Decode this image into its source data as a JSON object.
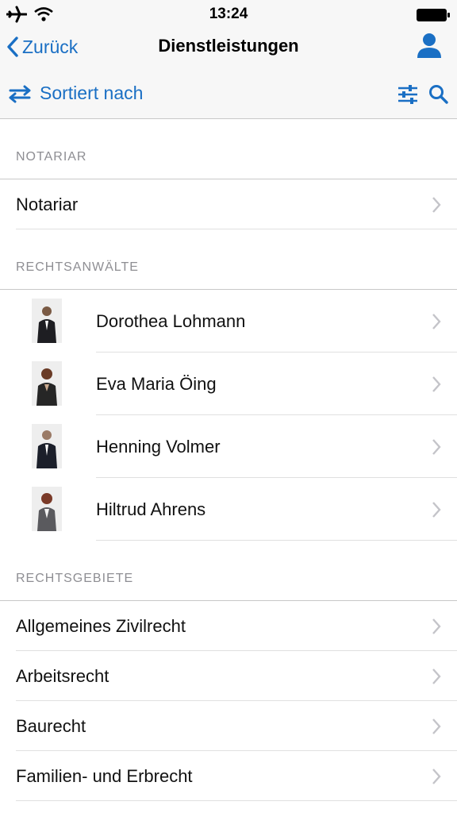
{
  "status_bar": {
    "time": "13:24"
  },
  "nav": {
    "back_label": "Zurück",
    "title": "Dienstleistungen"
  },
  "toolbar": {
    "sort_label": "Sortiert nach"
  },
  "sections": {
    "notariat": {
      "header": "NOTARIAR",
      "items": [
        "Notariar"
      ]
    },
    "lawyers": {
      "header": "RECHTSANWÄLTE",
      "items": [
        "Dorothea Lohmann",
        "Eva Maria Öing",
        "Henning Volmer",
        "Hiltrud Ahrens"
      ]
    },
    "areas": {
      "header": "RECHTSGEBIETE",
      "items": [
        "Allgemeines Zivilrecht",
        "Arbeitsrecht",
        "Baurecht",
        "Familien- und Erbrecht"
      ]
    }
  },
  "icons": {
    "airplane": "airplane-icon",
    "wifi": "wifi-icon",
    "battery": "battery-icon",
    "back": "chevron-left-icon",
    "profile": "user-icon",
    "sort": "swap-arrows-icon",
    "filter": "sliders-icon",
    "search": "search-icon",
    "disclosure": "chevron-right-icon"
  },
  "colors": {
    "accent": "#1a6fc4",
    "section_text": "#8e8e93",
    "separator": "#e0e0e0"
  }
}
